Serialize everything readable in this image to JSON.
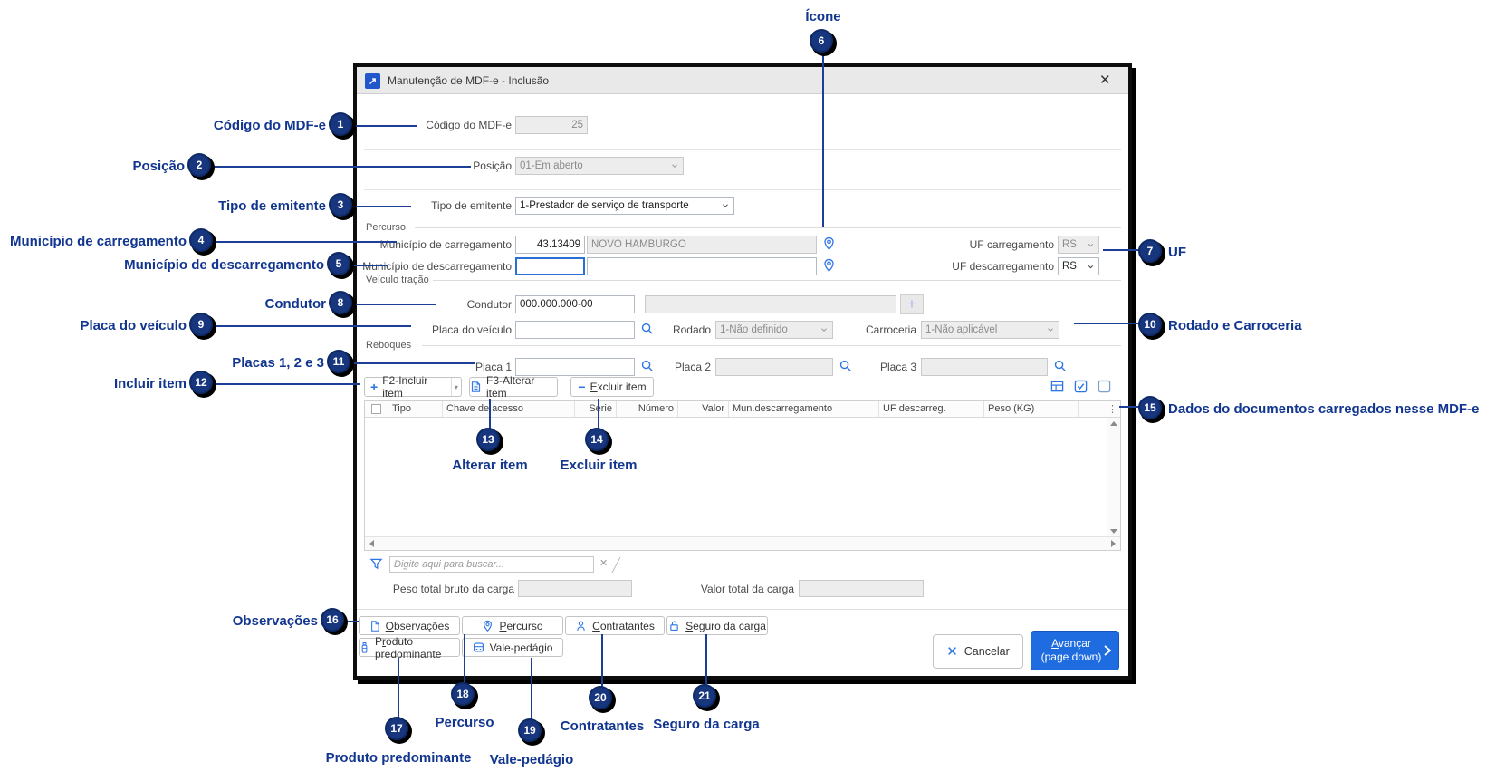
{
  "colors": {
    "accent": "#2e75e6",
    "annotation": "#12368f",
    "focus": "#2a6fd6",
    "primary_button": "#1f6be0",
    "badge": "#17367e"
  },
  "window": {
    "title": "Manutenção de MDF-e - Inclusão",
    "close_glyph": "✕",
    "app_icon_glyph": "↗"
  },
  "form": {
    "codigo": {
      "label": "Código do MDF-e",
      "value": "25"
    },
    "posicao": {
      "label": "Posição",
      "value": "01-Em aberto"
    },
    "tipo_emitente": {
      "label": "Tipo de emitente",
      "value": "1-Prestador de serviço de transporte"
    },
    "groups": {
      "percurso": "Percurso",
      "veiculo": "Veículo tração",
      "reboques": "Reboques"
    },
    "mun_carregamento": {
      "label": "Município de carregamento",
      "code": "43.13409",
      "name": "NOVO HAMBURGO"
    },
    "mun_descarregamento": {
      "label": "Município de descarregamento",
      "code": "",
      "name": ""
    },
    "uf_carregamento": {
      "label": "UF carregamento",
      "value": "RS"
    },
    "uf_descarregamento": {
      "label": "UF descarregamento",
      "value": "RS"
    },
    "condutor": {
      "label": "Condutor",
      "value": "000.000.000-00",
      "value2": ""
    },
    "placa_veiculo": {
      "label": "Placa do veículo",
      "value": ""
    },
    "rodado": {
      "label": "Rodado",
      "value": "1-Não definido"
    },
    "carroceria": {
      "label": "Carroceria",
      "value": "1-Não aplicável"
    },
    "placa1": {
      "label": "Placa 1",
      "value": ""
    },
    "placa2": {
      "label": "Placa 2",
      "value": ""
    },
    "placa3": {
      "label": "Placa 3",
      "value": ""
    }
  },
  "grid": {
    "toolbar": {
      "incluir": "F2-Incluir item",
      "alterar": "F3-Alterar item",
      "excluir": {
        "u": "E",
        "rest": "xcluir item"
      }
    },
    "columns": [
      "Tipo",
      "Chave de acesso",
      "Série",
      "Número",
      "Valor",
      "Mun.descarregamento",
      "UF descarreg.",
      "Peso (KG)"
    ],
    "rows": [],
    "search_placeholder": "Digite aqui para buscar...",
    "clear_glyph": "✕",
    "overflow_glyph": "⋮"
  },
  "totals": {
    "peso": {
      "label": "Peso total bruto da carga",
      "value": ""
    },
    "valor": {
      "label": "Valor total da carga",
      "value": ""
    }
  },
  "pages": {
    "observacoes": {
      "u": "O",
      "rest": "bservações"
    },
    "percurso": {
      "u": "P",
      "rest": "ercurso"
    },
    "contratantes": {
      "u": "C",
      "rest": "ontratantes"
    },
    "seguro": {
      "u": "S",
      "rest": "eguro da carga"
    },
    "produto": {
      "pre": "P",
      "u": "r",
      "rest": "oduto predominante"
    },
    "vale": {
      "pre": "Vale-pedá",
      "u": "g",
      "rest": "io"
    }
  },
  "actions": {
    "cancelar": "Cancelar",
    "avancar": {
      "u": "A",
      "rest": "vançar",
      "line2": "(page down)"
    }
  },
  "annotations": [
    {
      "n": "1",
      "label": "Código do MDF-e"
    },
    {
      "n": "2",
      "label": "Posição"
    },
    {
      "n": "3",
      "label": "Tipo de emitente"
    },
    {
      "n": "4",
      "label": "Município de carregamento"
    },
    {
      "n": "5",
      "label": "Município de descarregamento"
    },
    {
      "n": "6",
      "label": "Ícone"
    },
    {
      "n": "7",
      "label": "UF"
    },
    {
      "n": "8",
      "label": "Condutor"
    },
    {
      "n": "9",
      "label": "Placa do veículo"
    },
    {
      "n": "10",
      "label": "Rodado e Carroceria"
    },
    {
      "n": "11",
      "label": "Placas 1, 2 e 3"
    },
    {
      "n": "12",
      "label": "Incluir item"
    },
    {
      "n": "13",
      "label": "Alterar item"
    },
    {
      "n": "14",
      "label": "Excluir item"
    },
    {
      "n": "15",
      "label": "Dados do documentos carregados nesse MDF-e"
    },
    {
      "n": "16",
      "label": "Observações"
    },
    {
      "n": "17",
      "label": "Produto predominante"
    },
    {
      "n": "18",
      "label": "Percurso"
    },
    {
      "n": "19",
      "label": "Vale-pedágio"
    },
    {
      "n": "20",
      "label": "Contratantes"
    },
    {
      "n": "21",
      "label": "Seguro da carga"
    }
  ]
}
